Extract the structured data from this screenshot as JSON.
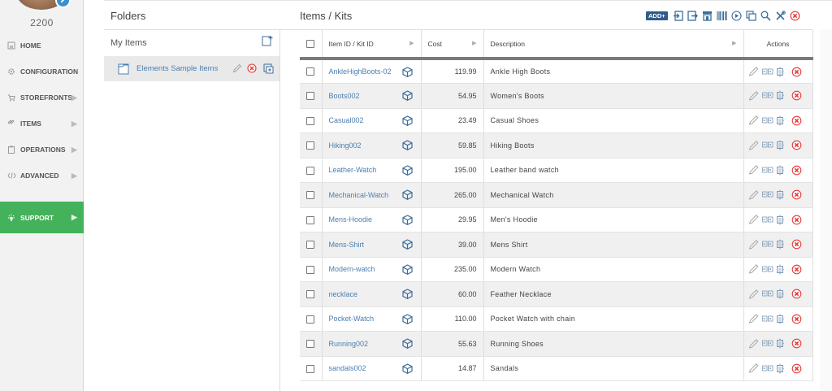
{
  "sidebar": {
    "account_number": "2200",
    "nav": [
      {
        "label": "HOME",
        "icon": "home-icon",
        "chevron": false,
        "active": false
      },
      {
        "label": "CONFIGURATION",
        "icon": "gear-icon",
        "chevron": false,
        "active": false
      },
      {
        "label": "STOREFRONTS",
        "icon": "cart-icon",
        "chevron": true,
        "active": false
      },
      {
        "label": "ITEMS",
        "icon": "tag-icon",
        "chevron": true,
        "active": false
      },
      {
        "label": "OPERATIONS",
        "icon": "clipboard-icon",
        "chevron": true,
        "active": false
      },
      {
        "label": "ADVANCED",
        "icon": "code-icon",
        "chevron": true,
        "active": false
      },
      {
        "label": "SUPPORT",
        "icon": "lightbulb-icon",
        "chevron": true,
        "active": true
      }
    ],
    "chevron_glyph": "▶"
  },
  "folders": {
    "title": "Folders",
    "my_items_label": "My Items",
    "items": [
      {
        "name": "Elements Sample Items"
      }
    ]
  },
  "items": {
    "title": "Items / Kits",
    "toolbar": {
      "add_label": "ADD+"
    },
    "columns": {
      "id": "Item ID / Kit ID",
      "cost": "Cost",
      "description": "Description",
      "actions": "Actions"
    },
    "rows": [
      {
        "id": "AnkleHighBoots-02",
        "cost": "119.99",
        "description": "Ankle High Boots"
      },
      {
        "id": "Boots002",
        "cost": "54.95",
        "description": "Women's Boots"
      },
      {
        "id": "Casual002",
        "cost": "23.49",
        "description": "Casual Shoes"
      },
      {
        "id": "Hiking002",
        "cost": "59.85",
        "description": "Hiking Boots"
      },
      {
        "id": "Leather-Watch",
        "cost": "195.00",
        "description": "Leather band watch"
      },
      {
        "id": "Mechanical-Watch",
        "cost": "265.00",
        "description": "Mechanical Watch"
      },
      {
        "id": "Mens-Hoodie",
        "cost": "29.95",
        "description": "Men's Hoodie"
      },
      {
        "id": "Mens-Shirt",
        "cost": "39.00",
        "description": "Mens Shirt"
      },
      {
        "id": "Modern-watch",
        "cost": "235.00",
        "description": "Modern Watch"
      },
      {
        "id": "necklace",
        "cost": "60.00",
        "description": "Feather Necklace"
      },
      {
        "id": "Pocket-Watch",
        "cost": "110.00",
        "description": "Pocket Watch with chain"
      },
      {
        "id": "Running002",
        "cost": "55.63",
        "description": "Running Shoes"
      },
      {
        "id": "sandals002",
        "cost": "14.87",
        "description": "Sandals"
      }
    ]
  },
  "colors": {
    "accent_green": "#43b25a",
    "link_blue": "#4a7fb0",
    "add_button": "#2f5c8a",
    "delete_red": "#e53935"
  }
}
